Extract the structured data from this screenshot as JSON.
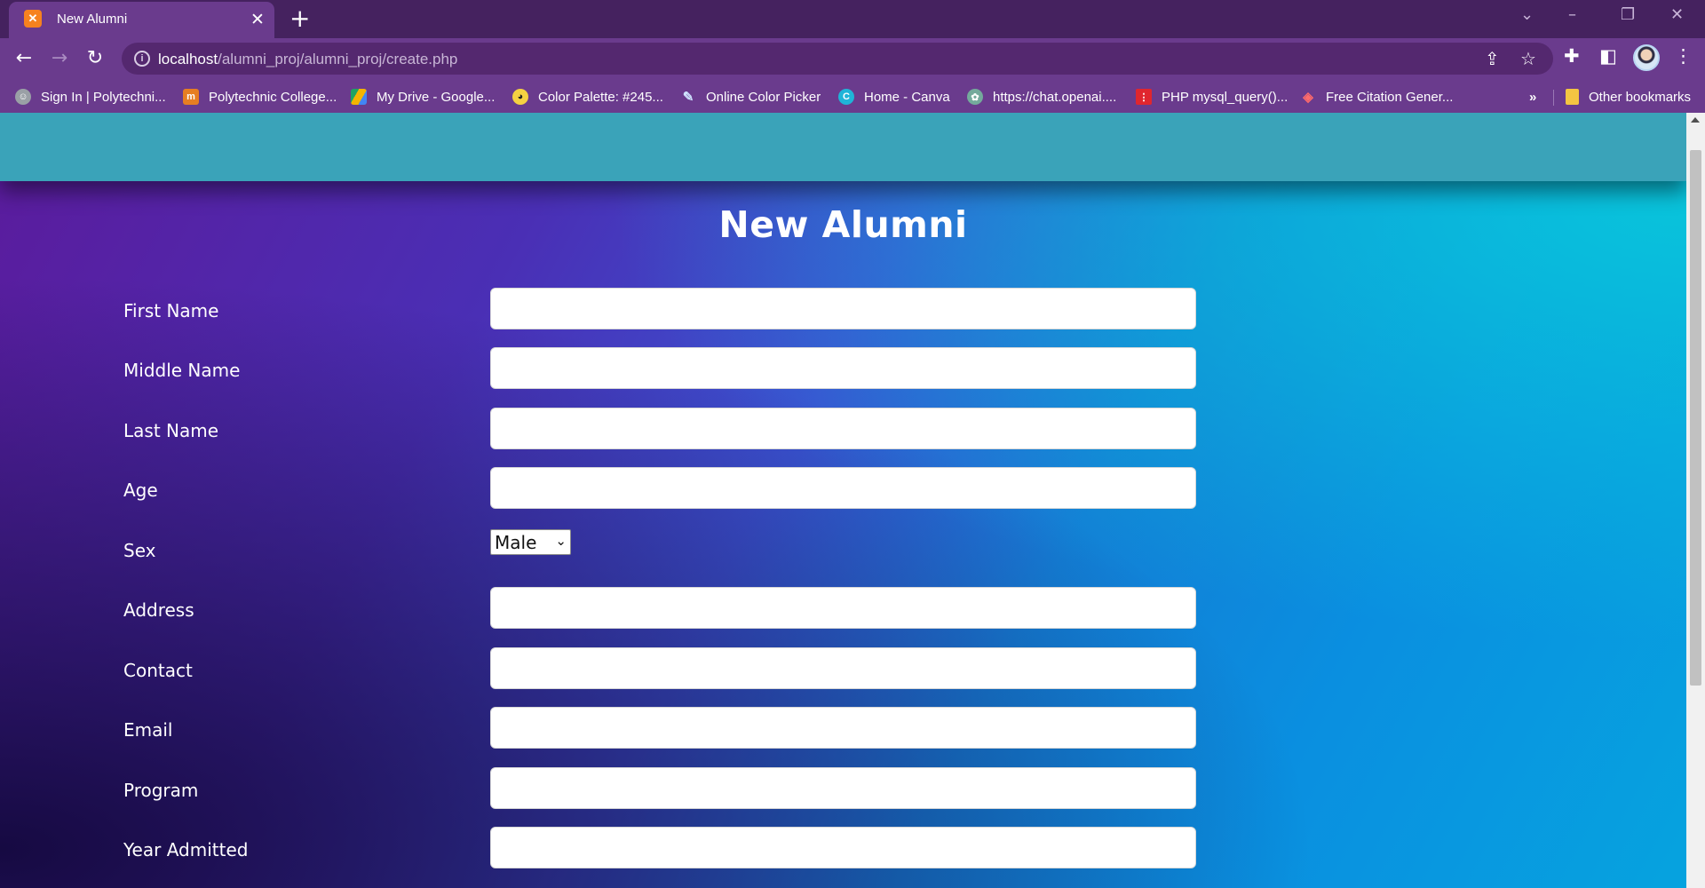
{
  "browser": {
    "tab_title": "New Alumni",
    "tab_favicon": "xampp-icon",
    "url_host": "localhost",
    "url_path": "/alumni_proj/alumni_proj/create.php",
    "bookmarks": [
      {
        "label": "Sign In | Polytechni...",
        "icon": "polytechnic-icon"
      },
      {
        "label": "Polytechnic College...",
        "icon": "college-icon"
      },
      {
        "label": "My Drive - Google...",
        "icon": "google-drive-icon"
      },
      {
        "label": "Color Palette: #245...",
        "icon": "palette-icon"
      },
      {
        "label": "Online Color Picker",
        "icon": "color-picker-icon"
      },
      {
        "label": "Home - Canva",
        "icon": "canva-icon"
      },
      {
        "label": "https://chat.openai....",
        "icon": "openai-icon"
      },
      {
        "label": "PHP mysql_query()...",
        "icon": "php-icon"
      },
      {
        "label": "Free Citation Gener...",
        "icon": "citation-icon"
      }
    ],
    "bookmarks_overflow": "»",
    "other_bookmarks": "Other bookmarks"
  },
  "page": {
    "title": "New Alumni",
    "fields": [
      {
        "label": "First Name",
        "value": ""
      },
      {
        "label": "Middle Name",
        "value": ""
      },
      {
        "label": "Last Name",
        "value": ""
      },
      {
        "label": "Age",
        "value": ""
      },
      {
        "label": "Sex",
        "selected": "Male"
      },
      {
        "label": "Address",
        "value": ""
      },
      {
        "label": "Contact",
        "value": ""
      },
      {
        "label": "Email",
        "value": ""
      },
      {
        "label": "Program",
        "value": ""
      },
      {
        "label": "Year Admitted",
        "value": ""
      }
    ]
  },
  "colors": {
    "browser_frame": "#6a3b8d",
    "page_header": "#3aa3b9",
    "gradient_purple": "#5b1b9c",
    "gradient_cyan": "#09c3db"
  }
}
